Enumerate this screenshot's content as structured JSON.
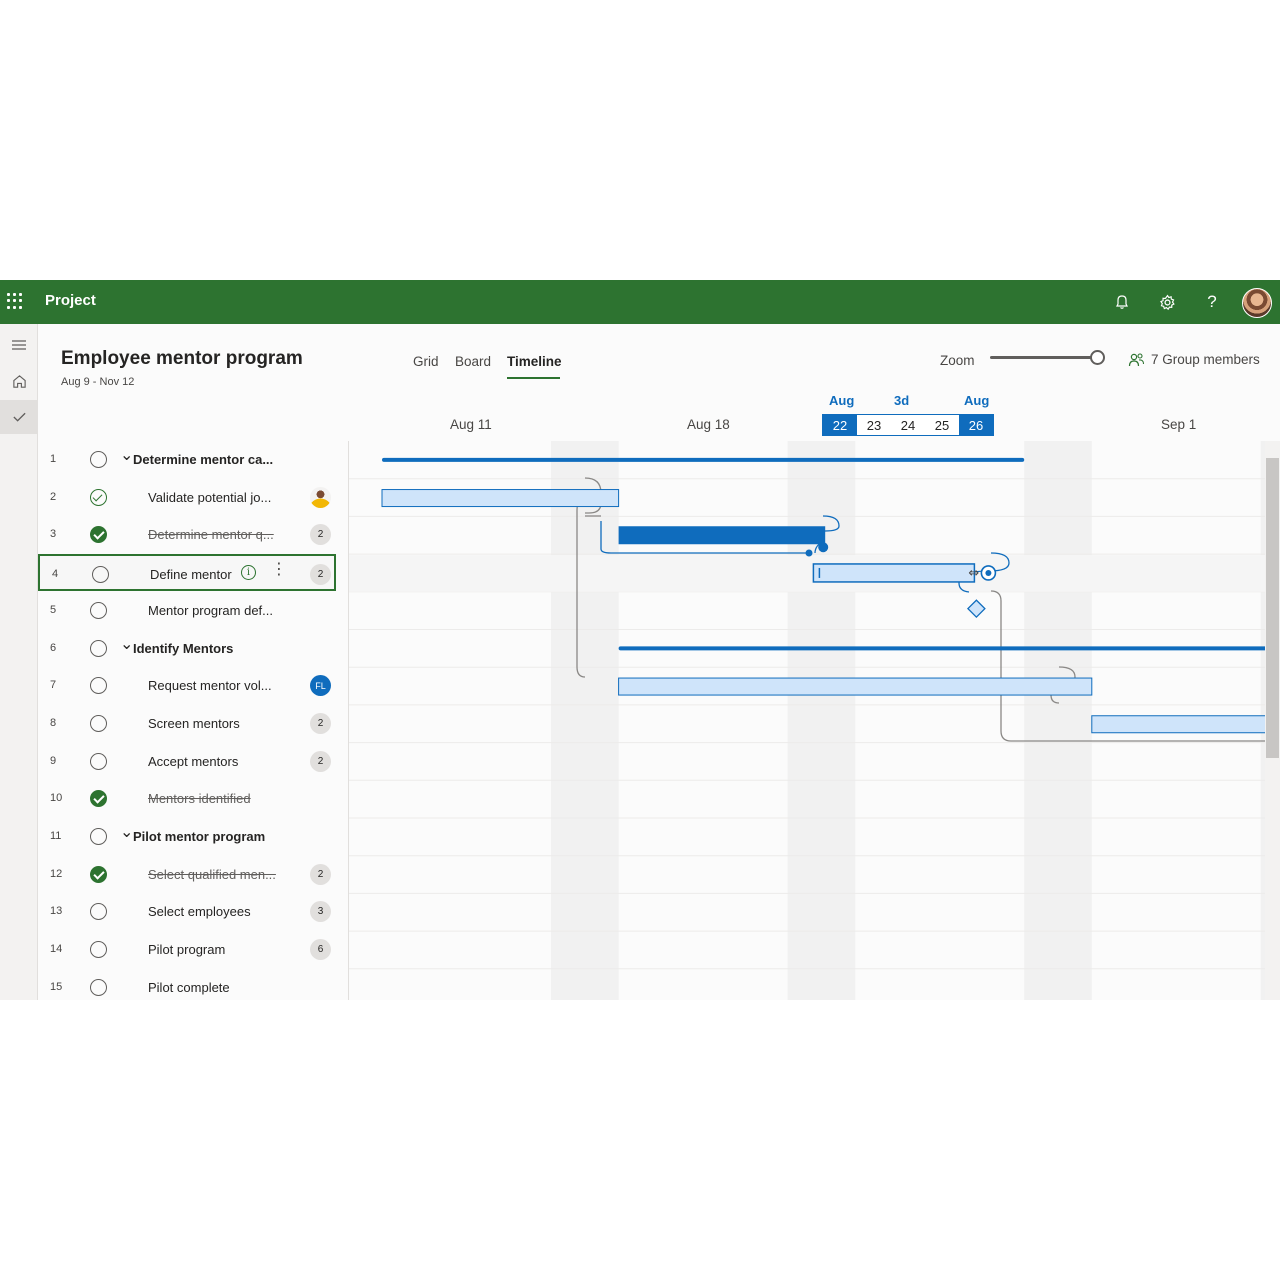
{
  "app": {
    "title": "Project"
  },
  "project": {
    "title": "Employee mentor program",
    "dates": "Aug 9 - Nov 12"
  },
  "views": {
    "grid": "Grid",
    "board": "Board",
    "timeline": "Timeline"
  },
  "zoom": {
    "label": "Zoom",
    "level": 1.0
  },
  "members": {
    "label": "7 Group members"
  },
  "timeline_header": {
    "dates": [
      "Aug 11",
      "Aug 18",
      "Sep 1"
    ],
    "selection": {
      "start_month": "Aug",
      "duration": "3d",
      "end_month": "Aug",
      "days": [
        "22",
        "23",
        "24",
        "25",
        "26"
      ]
    }
  },
  "tasks": [
    {
      "num": "1",
      "name": "Determine mentor ca...",
      "status": "open",
      "summary": true
    },
    {
      "num": "2",
      "name": "Validate potential jo...",
      "status": "partial",
      "assignee": "person"
    },
    {
      "num": "3",
      "name": "Determine mentor q...",
      "status": "done",
      "assignee": "2"
    },
    {
      "num": "4",
      "name": "Define mentor",
      "status": "open",
      "assignee": "2",
      "focused": true
    },
    {
      "num": "5",
      "name": "Mentor program def...",
      "status": "open"
    },
    {
      "num": "6",
      "name": "Identify Mentors",
      "status": "open",
      "summary": true
    },
    {
      "num": "7",
      "name": "Request mentor vol...",
      "status": "open",
      "assignee": "FL"
    },
    {
      "num": "8",
      "name": "Screen mentors",
      "status": "open",
      "assignee": "2"
    },
    {
      "num": "9",
      "name": "Accept mentors",
      "status": "open",
      "assignee": "2"
    },
    {
      "num": "10",
      "name": "Mentors identified",
      "status": "done"
    },
    {
      "num": "11",
      "name": "Pilot mentor program",
      "status": "open",
      "summary": true
    },
    {
      "num": "12",
      "name": "Select qualified men...",
      "status": "done",
      "assignee": "2"
    },
    {
      "num": "13",
      "name": "Select employees",
      "status": "open",
      "assignee": "3"
    },
    {
      "num": "14",
      "name": "Pilot program",
      "status": "open",
      "assignee": "6"
    },
    {
      "num": "15",
      "name": "Pilot complete",
      "status": "open"
    }
  ],
  "gantt": {
    "timeline_start": "2021-08-09",
    "bars": [
      {
        "row": 0,
        "kind": "summary",
        "start": "2021-08-09",
        "end": "2021-08-27"
      },
      {
        "row": 1,
        "kind": "task",
        "start": "2021-08-09",
        "end": "2021-08-15"
      },
      {
        "row": 2,
        "kind": "task-selected",
        "start": "2021-08-16",
        "end": "2021-08-22"
      },
      {
        "row": 3,
        "kind": "task-edit",
        "start": "2021-08-22",
        "end": "2021-08-26"
      },
      {
        "row": 4,
        "kind": "milestone",
        "start": "2021-08-27",
        "end": "2021-08-27"
      },
      {
        "row": 5,
        "kind": "summary",
        "start": "2021-08-16",
        "end": "2021-09-05"
      },
      {
        "row": 6,
        "kind": "task",
        "start": "2021-08-16",
        "end": "2021-08-29"
      },
      {
        "row": 7,
        "kind": "task",
        "start": "2021-08-30",
        "end": "2021-09-05"
      }
    ],
    "colors": {
      "primary": "#0f6cbd",
      "light": "#cfe4fa",
      "connector": "#8a8886"
    }
  }
}
